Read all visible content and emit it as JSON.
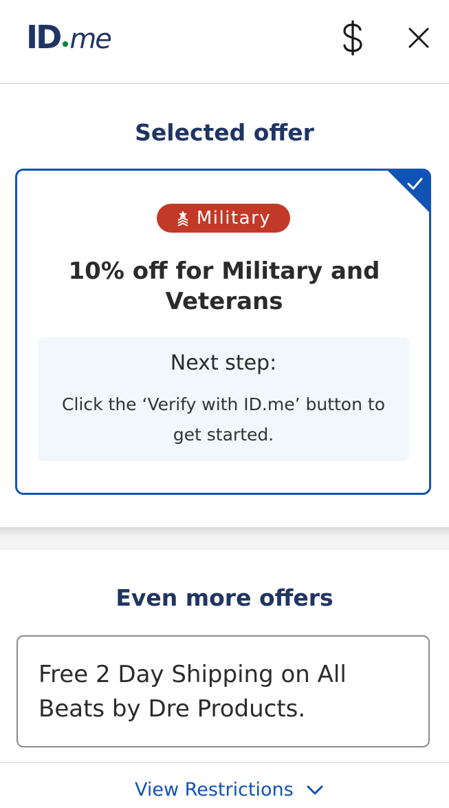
{
  "header": {
    "logo_id": "ID",
    "logo_me": "me",
    "dollar_glyph": "$",
    "close_icon": "close-icon"
  },
  "selected": {
    "title": "Selected offer",
    "badge_label": "Military",
    "offer_title": "10% off for Military and Veterans",
    "next_heading": "Next step:",
    "next_body": "Click the ‘Verify with ID.me’ button to get started.",
    "colors": {
      "accent": "#1152b5",
      "badge": "#c23a27",
      "title": "#1f3563"
    }
  },
  "more": {
    "title": "Even more offers",
    "offer_text": "Free 2 Day Shipping on All Beats by Dre Products."
  },
  "footer": {
    "restrictions_label": "View Restrictions"
  }
}
